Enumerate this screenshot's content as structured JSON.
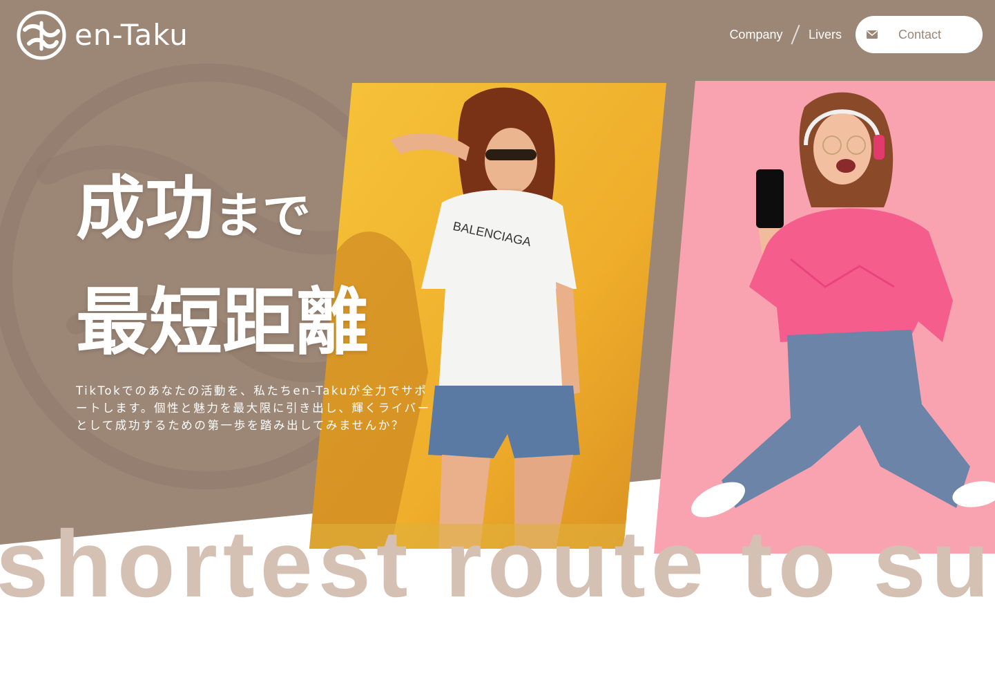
{
  "brand": {
    "name": "en-Taku",
    "logo_icon": "en-taku-emblem-icon"
  },
  "nav": {
    "items": [
      {
        "label": "Company"
      },
      {
        "label": "Livers"
      }
    ],
    "contact": {
      "label": "Contact",
      "icon": "mail-icon"
    }
  },
  "hero": {
    "headline_part1_big": "成功",
    "headline_part1_small": "まで",
    "headline_part2": "最短距離",
    "lead": "TikTokでのあなたの活動を、私たちen-Takuが全力でサポートします。個性と魅力を最大限に引き出し、輝くライバーとして成功するための第一歩を踏み出してみませんか？",
    "background_text": "shortest route to suc"
  },
  "colors": {
    "hero_background": "#9c8676",
    "accent_text": "#d5c1b3",
    "panel_yellow": "#f0b32e",
    "panel_pink": "#f9a2b0"
  }
}
